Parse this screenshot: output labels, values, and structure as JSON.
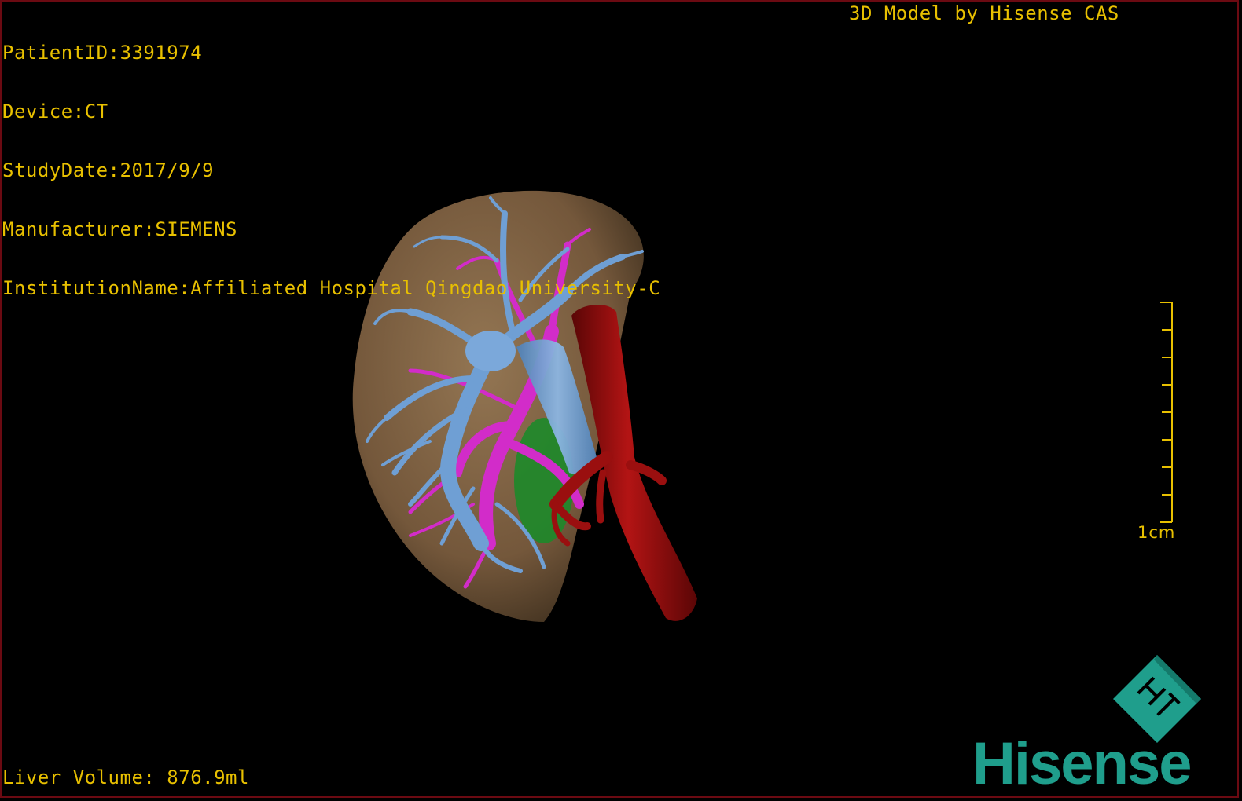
{
  "patient_info": {
    "patient_id": "PatientID:3391974",
    "device": "Device:CT",
    "study_date": "StudyDate:2017/9/9",
    "manufacturer": "Manufacturer:SIEMENS",
    "institution": "InstitutionName:Affiliated Hospital Qingdao University-C"
  },
  "model_credit": "3D Model by Hisense CAS",
  "liver_volume": "Liver Volume: 876.9ml",
  "scale": {
    "label": "1cm"
  },
  "logo": {
    "text": "Hisense",
    "mark_letters": "HT"
  },
  "colors": {
    "overlay_text": "#e8c000",
    "liver": "#8a6a48",
    "portal_vein": "#6f9fd4",
    "hepatic_vein": "#d22cc9",
    "aorta": "#9a0f0f",
    "gallbladder": "#1d8a2a",
    "logo": "#1f9e8c",
    "frame": "#6b0a12"
  }
}
